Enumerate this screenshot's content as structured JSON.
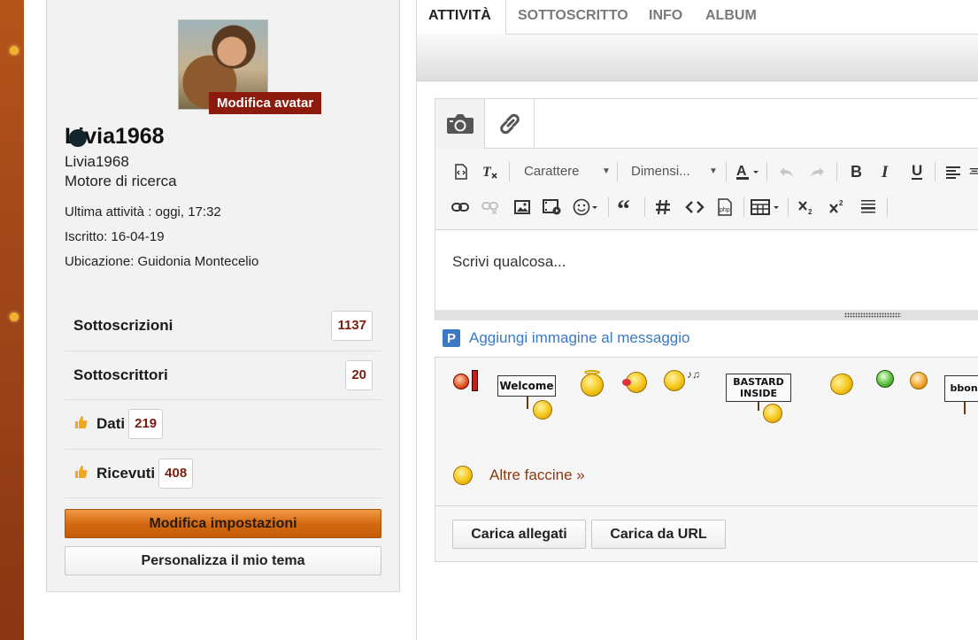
{
  "profile": {
    "avatar_edit_label": "Modifica avatar",
    "username": "Livia1968",
    "subname": "Livia1968",
    "subtitle": "Motore di ricerca",
    "last_activity": "Ultima attività  : oggi, 17:32",
    "registered": "Iscritto: 16-04-19",
    "location": "Ubicazione: Guidonia Montecelio",
    "stats": {
      "subscriptions_label": "Sottoscrizioni",
      "subscriptions_count": "1137",
      "subscribers_label": "Sottoscrittori",
      "subscribers_count": "20",
      "given_label": "Dati",
      "given_count": "219",
      "received_label": "Ricevuti",
      "received_count": "408"
    },
    "settings_button": "Modifica impostazioni",
    "theme_button": "Personalizza il mio tema"
  },
  "tabs": [
    "ATTIVITÀ",
    "SOTTOSCRITTO",
    "INFO",
    "ALBUM"
  ],
  "editor": {
    "font_dropdown": "Carattere",
    "size_dropdown": "Dimensi...",
    "placeholder": "Scrivi qualcosa...",
    "add_image_label": "Aggiungi immagine al messaggio",
    "more_smilies_label": "Altre faccine »",
    "upload_button": "Carica allegati",
    "upload_url_button": "Carica da URL"
  },
  "smilie_signs": {
    "welcome": "Welcome",
    "bastard": "BASTARD INSIDE",
    "boni": "bboni"
  },
  "icons": {
    "camera": "camera-icon",
    "link": "link-icon",
    "thumb": "thumbs-up-icon"
  },
  "colors": {
    "accent_orange": "#d46a12",
    "badge_red": "#8c1a0d",
    "link_blue": "#3b79c4",
    "count_color": "#7a1d0d"
  }
}
